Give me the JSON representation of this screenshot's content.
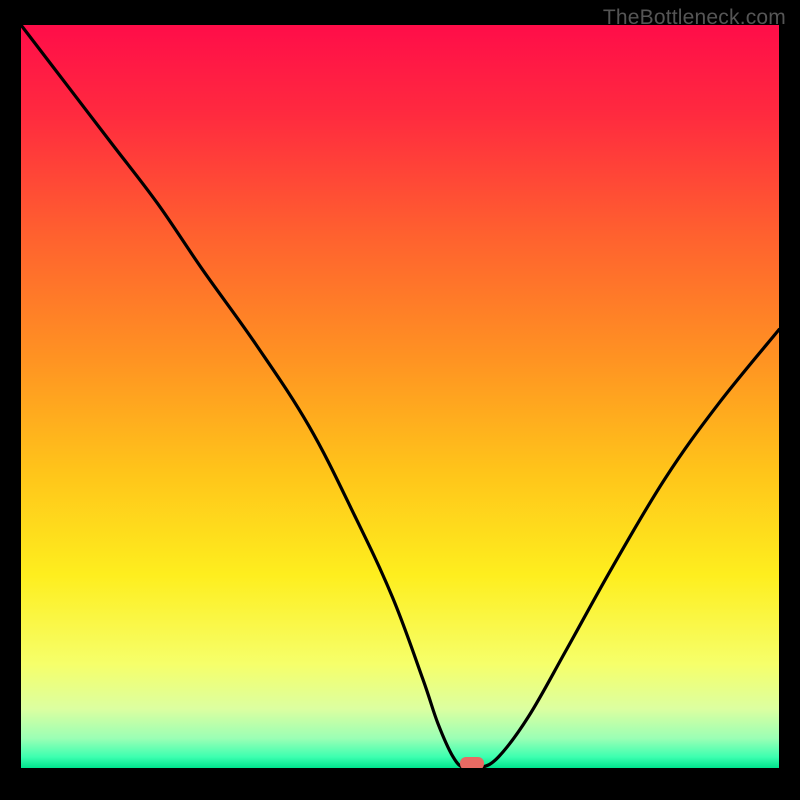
{
  "watermark": "TheBottleneck.com",
  "chart_data": {
    "type": "line",
    "title": "",
    "xlabel": "",
    "ylabel": "",
    "xlim": [
      0,
      100
    ],
    "ylim": [
      0,
      100
    ],
    "x": [
      0,
      6,
      12,
      18,
      24,
      31,
      38,
      44,
      49,
      53,
      55,
      57,
      58.5,
      60.5,
      63,
      67,
      72,
      78,
      85,
      92,
      100
    ],
    "y": [
      100,
      92,
      84,
      76,
      67,
      57,
      46,
      34,
      23,
      12,
      6,
      1.5,
      0,
      0,
      1.5,
      7,
      16,
      27,
      39,
      49,
      59
    ],
    "marker": {
      "x": 59.5,
      "y": 0.6
    },
    "gradient_stops": [
      {
        "offset": 0.0,
        "color": "#ff0d49"
      },
      {
        "offset": 0.12,
        "color": "#ff2a3f"
      },
      {
        "offset": 0.28,
        "color": "#ff602f"
      },
      {
        "offset": 0.45,
        "color": "#ff9322"
      },
      {
        "offset": 0.6,
        "color": "#ffc41a"
      },
      {
        "offset": 0.74,
        "color": "#feee1e"
      },
      {
        "offset": 0.86,
        "color": "#f6ff6a"
      },
      {
        "offset": 0.92,
        "color": "#dcffa0"
      },
      {
        "offset": 0.96,
        "color": "#9bffb5"
      },
      {
        "offset": 0.985,
        "color": "#3dffb0"
      },
      {
        "offset": 1.0,
        "color": "#00e48d"
      }
    ]
  }
}
